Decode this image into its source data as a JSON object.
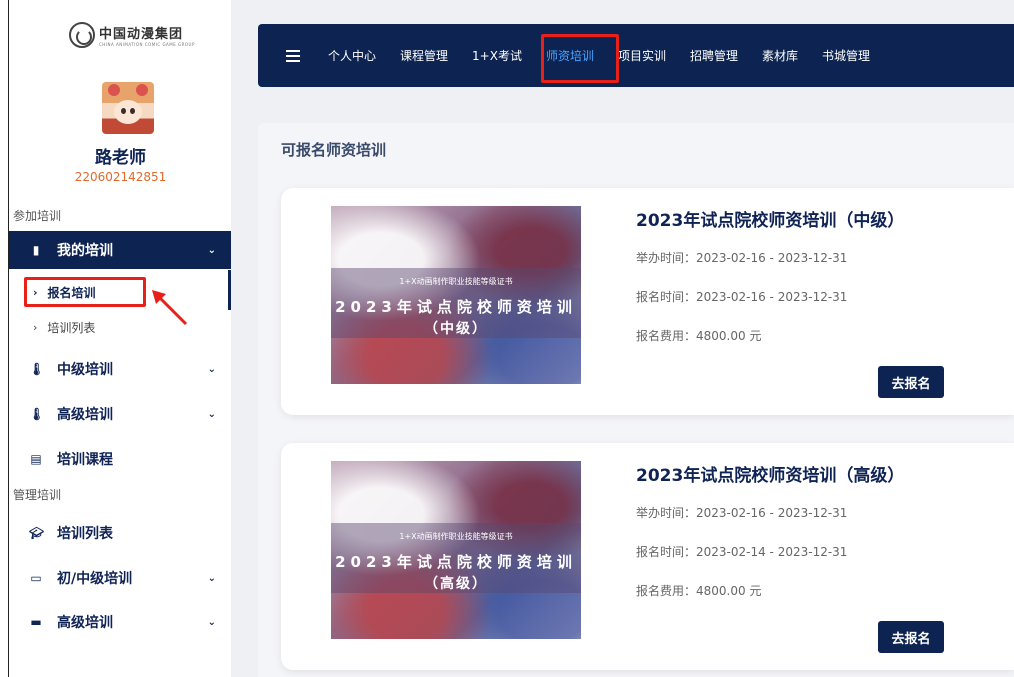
{
  "brand": {
    "name_cn": "中国动漫集团",
    "name_en": "CHINA ANIMATION COMIC GAME GROUP"
  },
  "user": {
    "name": "路老师",
    "id": "220602142851"
  },
  "sidebar": {
    "section_join": "参加培训",
    "section_manage": "管理培训",
    "items": [
      {
        "label": "我的培训",
        "icon": "clipboard-icon",
        "expanded": true
      },
      {
        "label": "中级培训",
        "icon": "thermometer-icon"
      },
      {
        "label": "高级培训",
        "icon": "thermometer-icon"
      },
      {
        "label": "培训课程",
        "icon": "book-icon"
      },
      {
        "label": "培训列表",
        "icon": "graduation-cap-icon"
      },
      {
        "label": "初/中级培训",
        "icon": "battery-icon"
      },
      {
        "label": "高级培训",
        "icon": "battery-full-icon"
      }
    ],
    "subitems": [
      {
        "label": "报名培训",
        "active": true
      },
      {
        "label": "培训列表"
      }
    ]
  },
  "topnav": {
    "items": [
      "个人中心",
      "课程管理",
      "1+X考试",
      "师资培训",
      "项目实训",
      "招聘管理",
      "素材库",
      "书城管理"
    ],
    "active": "师资培训"
  },
  "panel": {
    "title": "可报名师资培训"
  },
  "cards": [
    {
      "image_small": "1+X动画制作职业技能等级证书",
      "image_big": "2023年试点院校师资培训",
      "image_level": "（中级）",
      "title": "2023年试点院校师资培训（中级）",
      "held": "举办时间：2023-02-16 - 2023-12-31",
      "signup": "报名时间：2023-02-16 - 2023-12-31",
      "fee": "报名费用：4800.00 元",
      "button": "去报名"
    },
    {
      "image_small": "1+X动画制作职业技能等级证书",
      "image_big": "2023年试点院校师资培训",
      "image_level": "（高级）",
      "title": "2023年试点院校师资培训（高级）",
      "held": "举办时间：2023-02-16 - 2023-12-31",
      "signup": "报名时间：2023-02-14 - 2023-12-31",
      "fee": "报名费用：4800.00 元",
      "button": "去报名"
    }
  ],
  "colors": {
    "navy": "#0d2452",
    "accent_blue": "#4aa3ff",
    "highlight_red": "#e8201a",
    "id_orange": "#e06a2c"
  }
}
